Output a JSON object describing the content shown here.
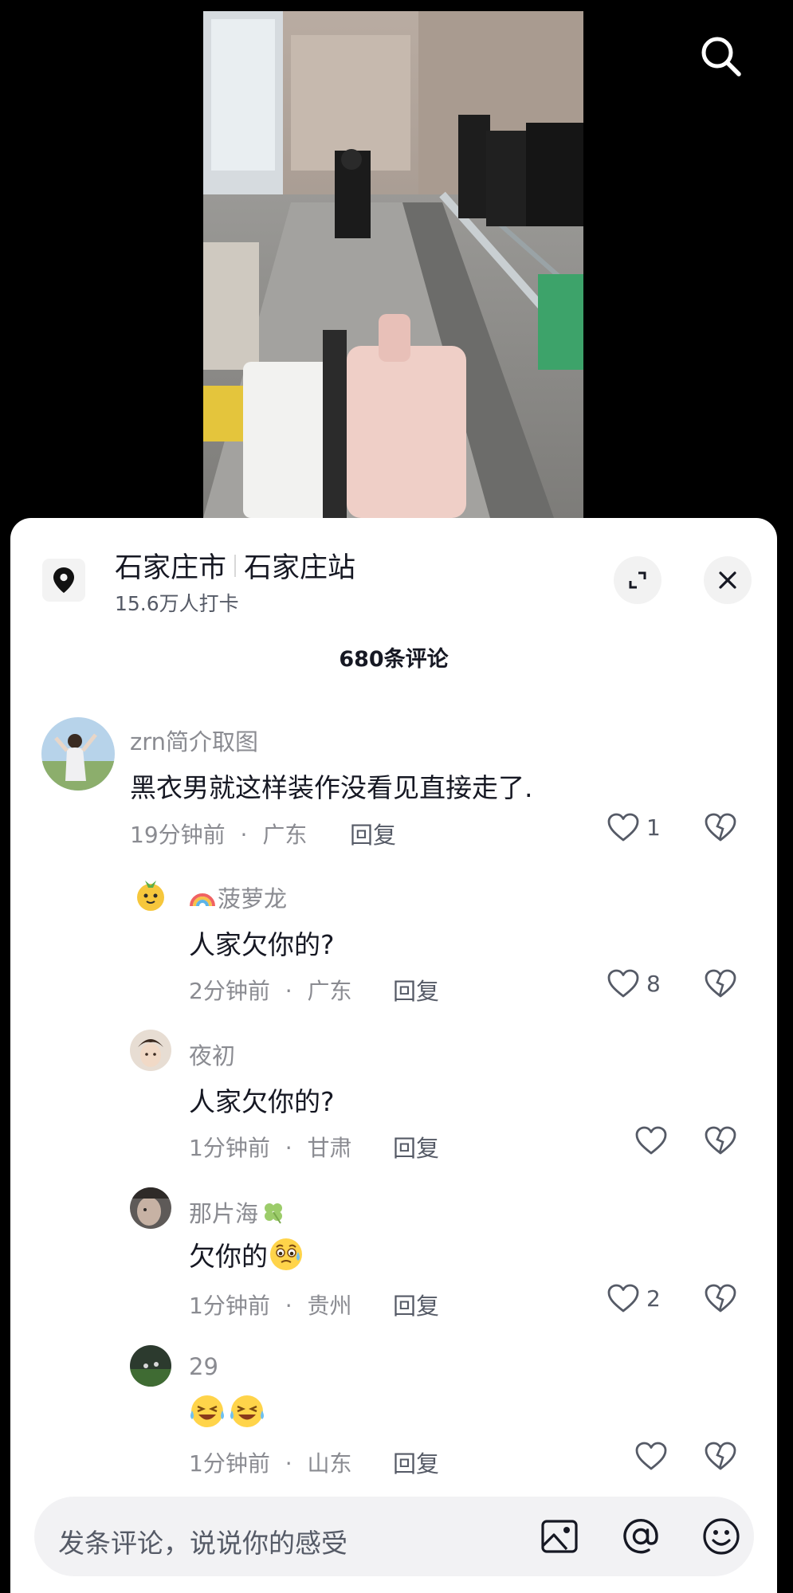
{
  "location": {
    "city": "石家庄市",
    "station": "石家庄站",
    "checkins": "15.6万人打卡"
  },
  "comment_count": "680条评论",
  "comments": [
    {
      "user": "zrn简介取图",
      "text": "黑衣男就这样装作没看见直接走了.",
      "time": "19分钟前",
      "region": "广东",
      "reply_label": "回复",
      "likes": "1"
    },
    {
      "user": "菠萝龙",
      "user_badge": "rainbow-icon",
      "text": "人家欠你的?",
      "time": "2分钟前",
      "region": "广东",
      "reply_label": "回复",
      "likes": "8"
    },
    {
      "user": "夜初",
      "text": "人家欠你的?",
      "time": "1分钟前",
      "region": "甘肃",
      "reply_label": "回复",
      "likes": ""
    },
    {
      "user": "那片海",
      "user_badge": "clover-icon",
      "text": "欠你的",
      "text_emoji": "sweat-face-emoji",
      "time": "1分钟前",
      "region": "贵州",
      "reply_label": "回复",
      "likes": "2"
    },
    {
      "user": "29",
      "text": "",
      "text_emoji": "laughing-tears-emoji x2",
      "time": "1分钟前",
      "region": "山东",
      "reply_label": "回复",
      "likes": ""
    }
  ],
  "input": {
    "placeholder": "发条评论，说说你的感受"
  },
  "meta_separator": "·",
  "colors": {
    "primary_text": "#161823",
    "secondary_text": "#8a8b91",
    "sheet_bg": "#ffffff",
    "input_bg": "#f2f2f4"
  }
}
